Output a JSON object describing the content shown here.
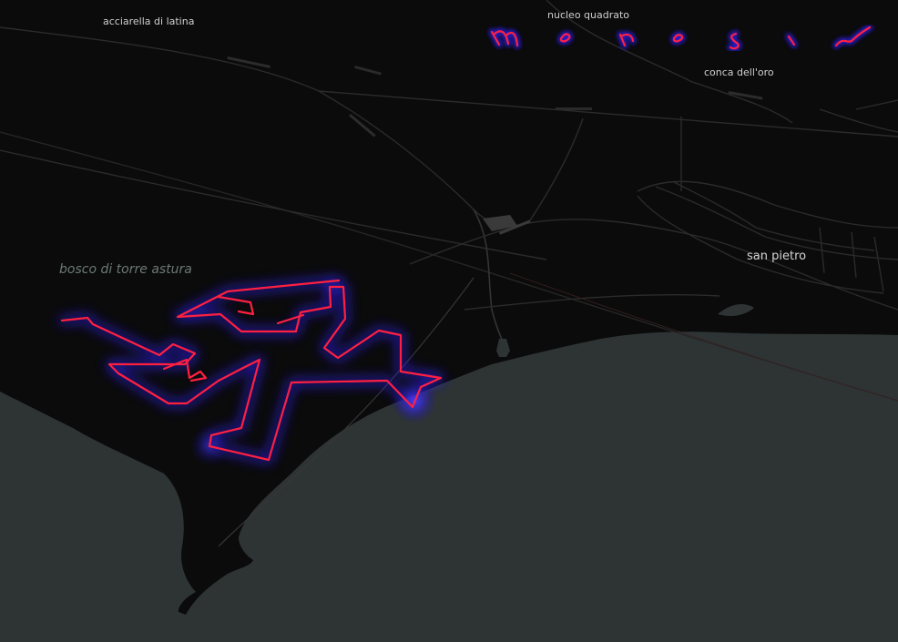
{
  "map": {
    "labels": {
      "acciarella": "acciarella di latina",
      "nucleo": "nucleo quadrato",
      "conca": "conca dell'oro",
      "san_pietro": "san pietro",
      "bosco": "bosco di torre astura"
    },
    "brand_logo": "MOROSIN",
    "colors": {
      "land": "#0b0b0b",
      "sea": "#2e3434",
      "road": "#2d2d2d",
      "route_line": "#ff2040",
      "route_glow": "#2a1cff"
    }
  }
}
